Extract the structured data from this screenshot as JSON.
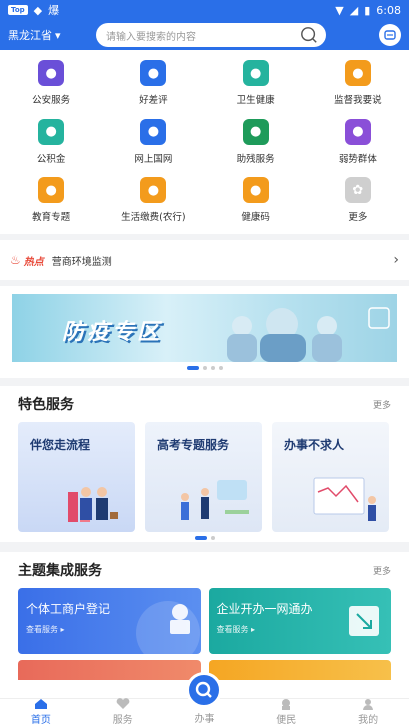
{
  "status": {
    "left_badge": "Top",
    "flag": "爆",
    "time": "6:08"
  },
  "header": {
    "region": "黑龙江省",
    "search_placeholder": "请输入要搜索的内容"
  },
  "grid": [
    {
      "label": "公安服务",
      "color": "#6a4fd8",
      "icon": "shield-icon"
    },
    {
      "label": "好差评",
      "color": "#2a6fe8",
      "icon": "like-icon"
    },
    {
      "label": "卫生健康",
      "color": "#25b39e",
      "icon": "medical-icon"
    },
    {
      "label": "监督我要说",
      "color": "#f39b1c",
      "icon": "message-icon"
    },
    {
      "label": "公积金",
      "color": "#25b39e",
      "icon": "house-icon"
    },
    {
      "label": "网上国网",
      "color": "#2a6fe8",
      "icon": "globe-icon"
    },
    {
      "label": "助残服务",
      "color": "#1e9b5a",
      "icon": "wheelchair-icon"
    },
    {
      "label": "弱势群体",
      "color": "#8a4fd8",
      "icon": "group-icon"
    },
    {
      "label": "教育专题",
      "color": "#f39b1c",
      "icon": "education-icon"
    },
    {
      "label": "生活缴费(农行)",
      "color": "#f39b1c",
      "icon": "payment-icon"
    },
    {
      "label": "健康码",
      "color": "#f39b1c",
      "icon": "qrcode-icon"
    },
    {
      "label": "更多",
      "color": "#cfcfcf",
      "icon": "more-icon"
    }
  ],
  "hot": {
    "tag": "热点",
    "text": "营商环境监测"
  },
  "banner": {
    "title": "防疫专区"
  },
  "featured": {
    "title": "特色服务",
    "more": "更多",
    "cards": [
      {
        "title": "伴您走流程"
      },
      {
        "title": "高考专题服务"
      },
      {
        "title": "办事不求人"
      }
    ]
  },
  "theme": {
    "title": "主题集成服务",
    "more": "更多",
    "cards": [
      {
        "title": "个体工商户登记",
        "sub": "查看服务 ▸"
      },
      {
        "title": "企业开办一网通办",
        "sub": "查看服务 ▸"
      }
    ]
  },
  "tabs": [
    {
      "label": "首页"
    },
    {
      "label": "服务"
    },
    {
      "label": "办事"
    },
    {
      "label": "便民"
    },
    {
      "label": "我的"
    }
  ]
}
